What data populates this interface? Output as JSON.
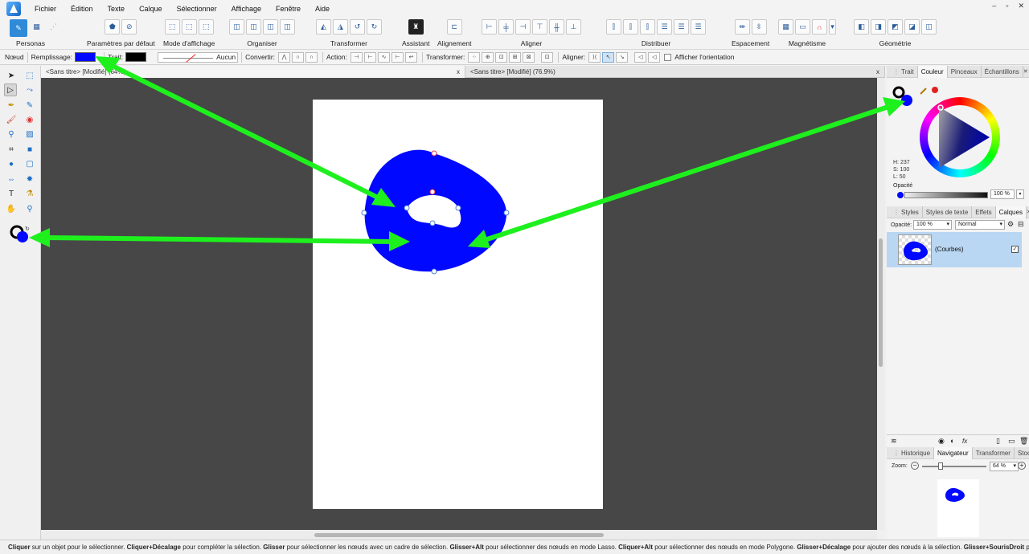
{
  "menubar": {
    "items": [
      "Fichier",
      "Édition",
      "Texte",
      "Calque",
      "Sélectionner",
      "Affichage",
      "Fenêtre",
      "Aide"
    ],
    "win_min": "–",
    "win_max": "▫",
    "win_close": "✕"
  },
  "toolbar": {
    "personas": "Personas",
    "defaults": "Paramètres par défaut",
    "view_mode": "Mode d'affichage",
    "arrange": "Organiser",
    "transform": "Transformer",
    "assistant": "Assistant",
    "alignment": "Alignement",
    "align": "Aligner",
    "distribute": "Distribuer",
    "spacing": "Espacement",
    "snapping": "Magnétisme",
    "geometry": "Géométrie"
  },
  "context": {
    "tool": "Nœud",
    "fill_label": "Remplissage:",
    "stroke_label": "Trait:",
    "stroke_none": "Aucun",
    "convert_label": "Convertir:",
    "action_label": "Action:",
    "transform_label": "Transformer:",
    "align_label": "Aligner:",
    "show_orientation": "Afficher l'orientation",
    "fill_color": "#0008ff",
    "stroke_color": "#000000"
  },
  "tabs": {
    "doc1": "<Sans titre> [Modifié] (64%)",
    "doc2": "<Sans titre> [Modifié] (76.9%)",
    "close": "x",
    "panel_close": "✕"
  },
  "color_panel": {
    "tabs": [
      "Trait",
      "Couleur",
      "Pinceaux",
      "Échantillons"
    ],
    "active_tab": "Couleur",
    "h": "H: 237",
    "s": "S: 100",
    "l": "L: 50",
    "opacity_label": "Opacité",
    "opacity_value": "100 %"
  },
  "layers_panel": {
    "tabs": [
      "Styles",
      "Styles de texte",
      "Effets",
      "Calques"
    ],
    "active_tab": "Calques",
    "opacity_label": "Opacité:",
    "opacity_value": "100 %",
    "blend_mode": "Normal",
    "layer_name": "(Courbes)",
    "layer_check": "✓",
    "fx": "fx"
  },
  "nav_panel": {
    "tabs": [
      "Historique",
      "Navigateur",
      "Transformer",
      "Stock"
    ],
    "active_tab": "Navigateur",
    "zoom_label": "Zoom:",
    "zoom_value": "64 %",
    "zoom_minus": "−",
    "zoom_plus": "+"
  },
  "status": {
    "parts": [
      {
        "b": "Cliquer",
        "t": " sur un objet pour le sélectionner. "
      },
      {
        "b": "Cliquer+Décalage",
        "t": " pour compléter la sélection. "
      },
      {
        "b": "Glisser",
        "t": " pour sélectionner les nœuds avec un cadre de sélection. "
      },
      {
        "b": "Glisser+Alt",
        "t": " pour sélectionner des nœuds en mode Lasso. "
      },
      {
        "b": "Cliquer+Alt",
        "t": " pour sélectionner des nœuds en mode Polygone. "
      },
      {
        "b": "Glisser+Décalage",
        "t": " pour ajouter des nœuds à la sélection. "
      },
      {
        "b": "Glisser+SourisDroit",
        "t": " pour"
      }
    ]
  },
  "colors": {
    "shape_fill": "#0008ff",
    "arrow": "#1ef01e",
    "node_selected": "#e0304a",
    "canvas_bg": "#474747"
  }
}
